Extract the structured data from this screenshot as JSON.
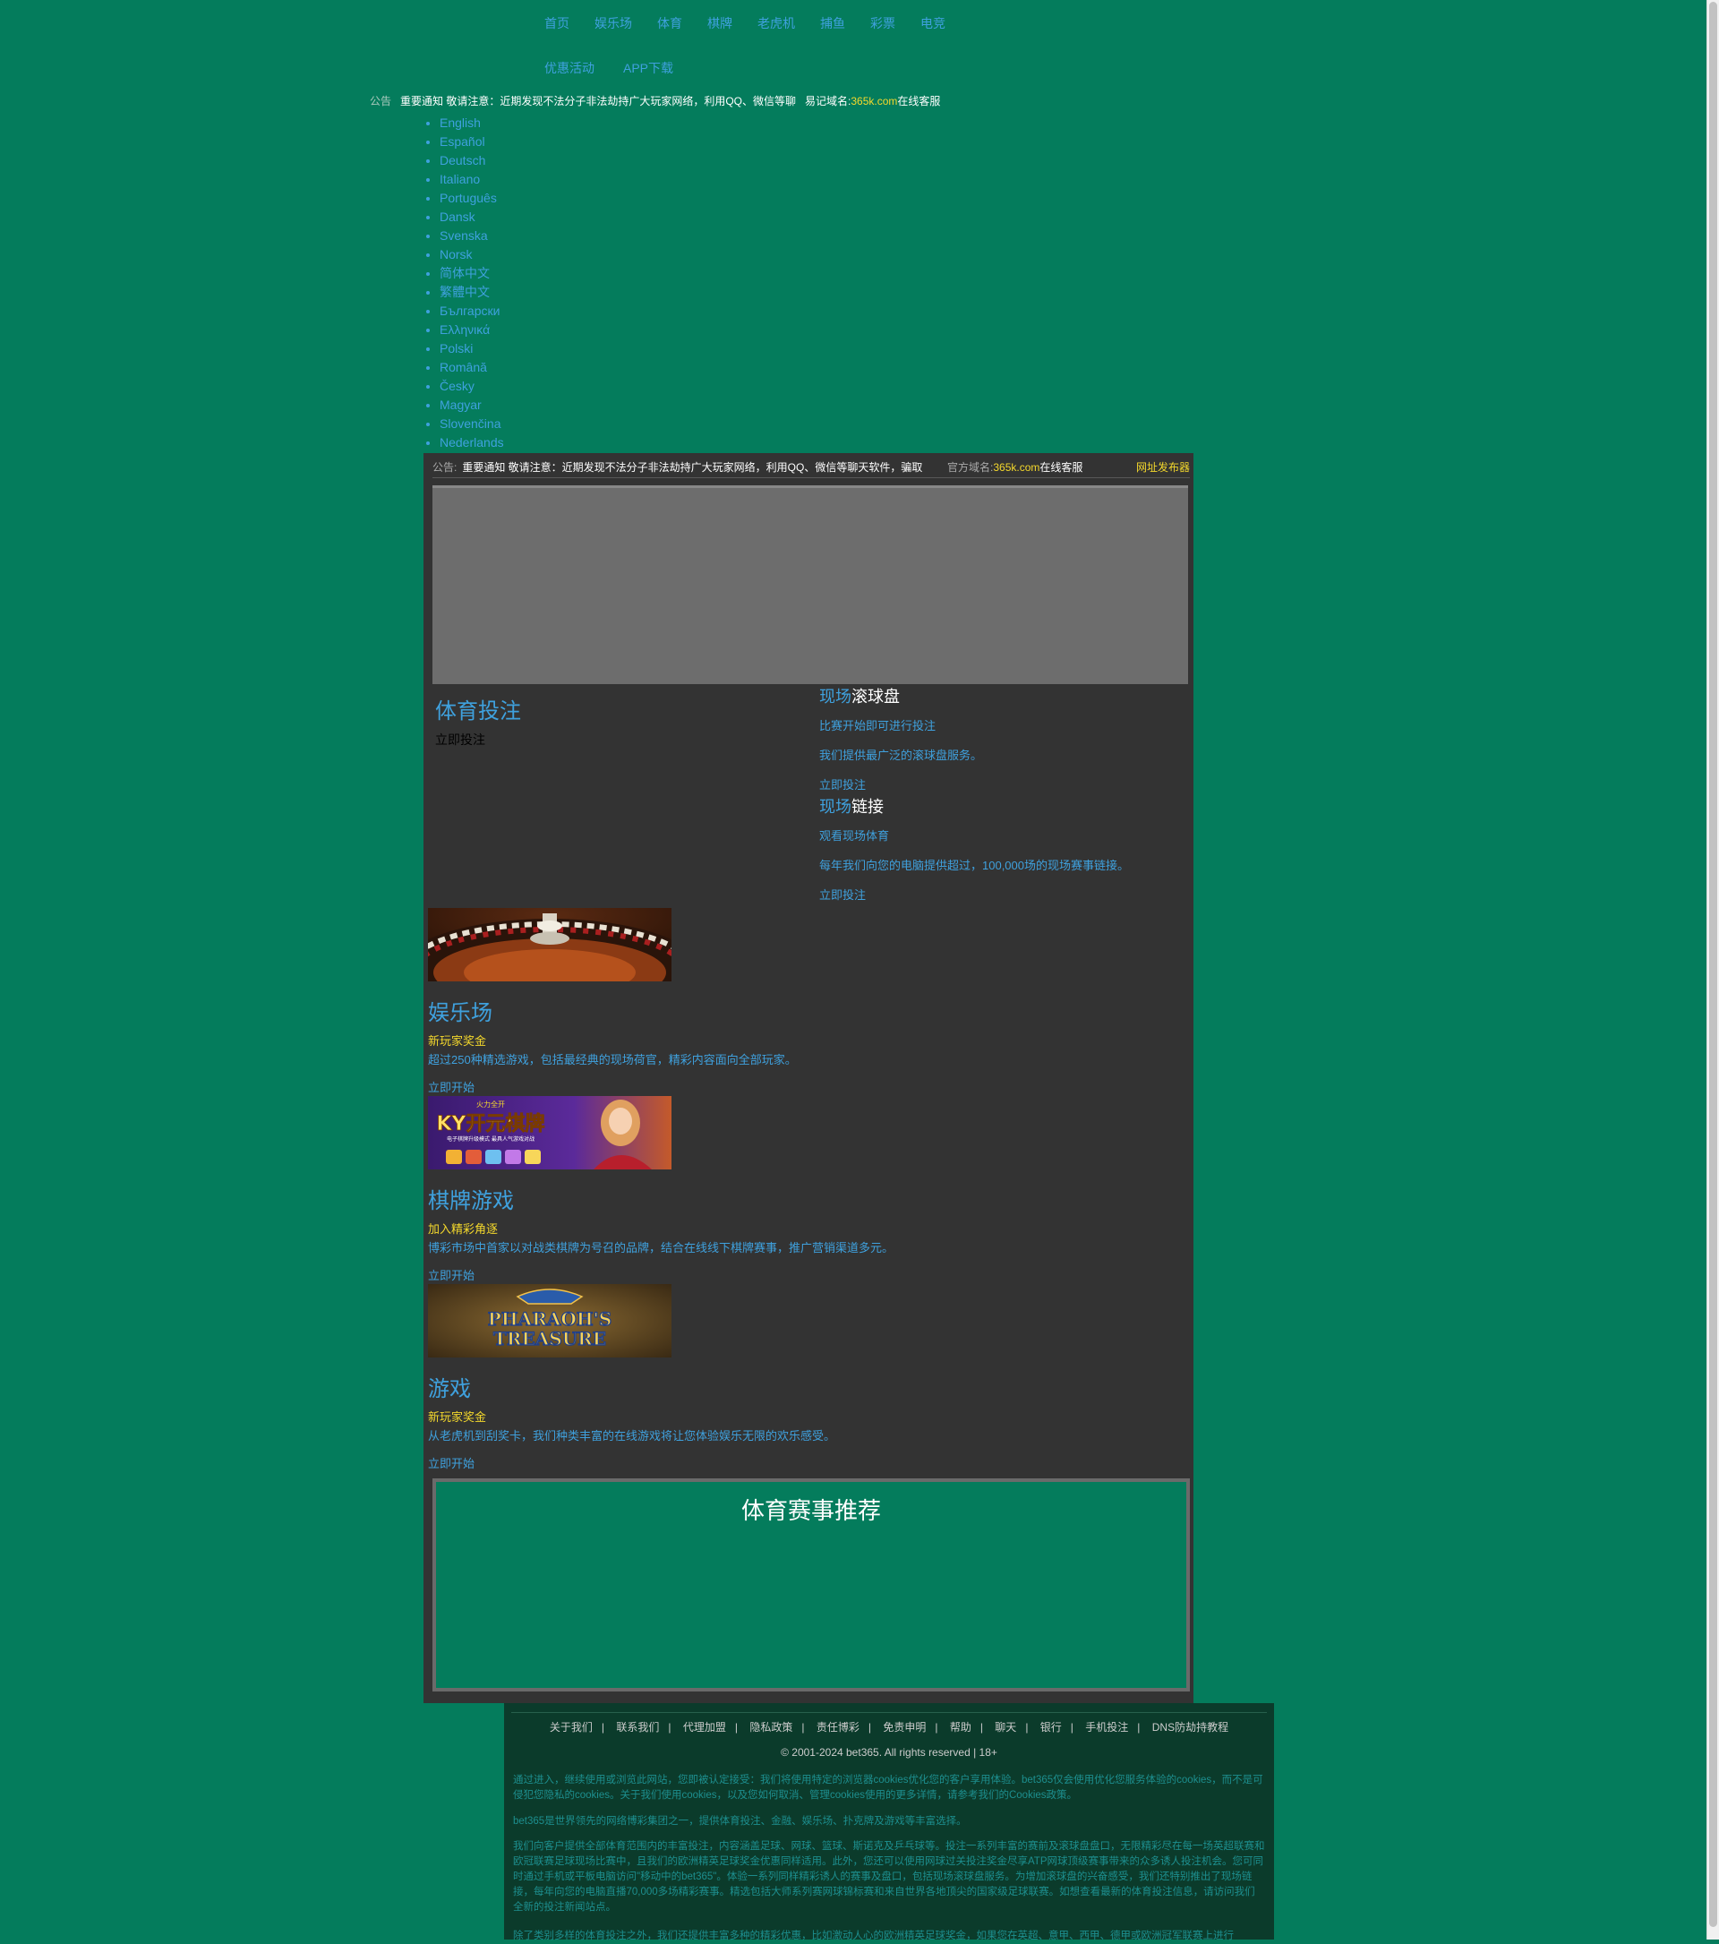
{
  "nav": {
    "row1": [
      "首页",
      "娱乐场",
      "体育",
      "棋牌",
      "老虎机",
      "捕鱼",
      "彩票",
      "电竞"
    ],
    "row2": [
      "优惠活动",
      "APP下载"
    ]
  },
  "notice_top": {
    "label": "公告",
    "text": "重要通知 敬请注意：近期发现不法分子非法劫持广大玩家网络，利用QQ、微信等聊",
    "domain_label": "易记域名:",
    "domain": "365k.com",
    "domain_suffix": "在线客服"
  },
  "languages": [
    "English",
    "Español",
    "Deutsch",
    "Italiano",
    "Português",
    "Dansk",
    "Svenska",
    "Norsk",
    "简体中文",
    "繁體中文",
    "Български",
    "Ελληνικά",
    "Polski",
    "Română",
    "Česky",
    "Magyar",
    "Slovenčina",
    "Nederlands"
  ],
  "notice_panel": {
    "label": "公告:",
    "text": "重要通知 敬请注意：近期发现不法分子非法劫持广大玩家网络，利用QQ、微信等聊天软件，骗取",
    "domain_label": "官方域名:",
    "domain": "365k.com",
    "domain_suffix": "在线客服",
    "publisher": "网址发布器"
  },
  "sports": {
    "title": "体育投注",
    "link": "立即投注"
  },
  "live": {
    "title_a": "现场",
    "title_b": "滚球盘",
    "line1": "比赛开始即可进行投注",
    "line2": "我们提供最广泛的滚球盘服务。",
    "link": "立即投注"
  },
  "stream": {
    "title_a": "现场",
    "title_b": "链接",
    "line1": "观看现场体育",
    "line2": "每年我们向您的电脑提供超过，100,000场的现场赛事链接。",
    "link": "立即投注"
  },
  "casino": {
    "title": "娱乐场",
    "tag": "新玩家奖金",
    "desc": "超过250种精选游戏，包括最经典的现场荷官，精彩内容面向全部玩家。",
    "link": "立即开始"
  },
  "poker": {
    "title": "棋牌游戏",
    "tag": "加入精彩角逐",
    "desc": "博彩市场中首家以对战类棋牌为号召的品牌，结合在线线下棋牌赛事，推广营销渠道多元。",
    "link": "立即开始",
    "banner_title": "KY开元棋牌",
    "banner_top": "火力全开",
    "banner_sub": "电子棋牌升级模式 最具人气游戏对战"
  },
  "games": {
    "title": "游戏",
    "tag": "新玩家奖金",
    "desc": "从老虎机到刮奖卡，我们种类丰富的在线游戏将让您体验娱乐无限的欢乐感受。",
    "link": "立即开始",
    "banner_title_1": "PHARAOH'S",
    "banner_title_2": "TREASURE"
  },
  "events": {
    "title": "体育赛事推荐"
  },
  "footer": {
    "links": [
      "关于我们",
      "联系我们",
      "代理加盟",
      "隐私政策",
      "责任博彩",
      "免责申明",
      "帮助",
      "聊天",
      "银行",
      "手机投注",
      "DNS防劫持教程"
    ],
    "copyright": "© 2001-2024 bet365. All rights reserved | 18+",
    "p1": "通过进入，继续使用或浏览此网站，您即被认定接受：我们将使用特定的浏览器cookies优化您的客户享用体验。bet365仅会使用优化您服务体验的cookies，而不是可侵犯您隐私的cookies。关于我们使用cookies，以及您如何取消、管理cookies使用的更多详情，请参考我们的Cookies政策。",
    "p2": "bet365是世界领先的网络博彩集团之一，提供体育投注、金融、娱乐场、扑克牌及游戏等丰富选择。",
    "p3": "我们向客户提供全部体育范围内的丰富投注，内容涵盖足球、网球、篮球、斯诺克及乒乓球等。投注一系列丰富的赛前及滚球盘盘口，无限精彩尽在每一场英超联赛和欧冠联赛足球现场比赛中，且我们的欧洲精英足球奖金优惠同样适用。此外，您还可以使用网球过关投注奖金尽享ATP网球顶级赛事带来的众多诱人投注机会。您可同时通过手机或平板电脑访问\"移动中的bet365\"。体验一系列同样精彩诱人的赛事及盘口，包括现场滚球盘服务。为增加滚球盘的兴奋感受，我们还特别推出了现场链接，每年向您的电脑直播70,000多场精彩赛事。精选包括大师系列赛网球锦标赛和来自世界各地顶尖的国家级足球联赛。如想查看最新的体育投注信息，请访问我们全新的投注新闻站点。",
    "p4": "除了类别多样的体育投注之外，我们还提供丰富多种的精彩优惠，比如激动人心的欧洲精英足球奖金，如果您在英超、意甲、西甲、德甲或欧洲冠军联赛上进行"
  }
}
